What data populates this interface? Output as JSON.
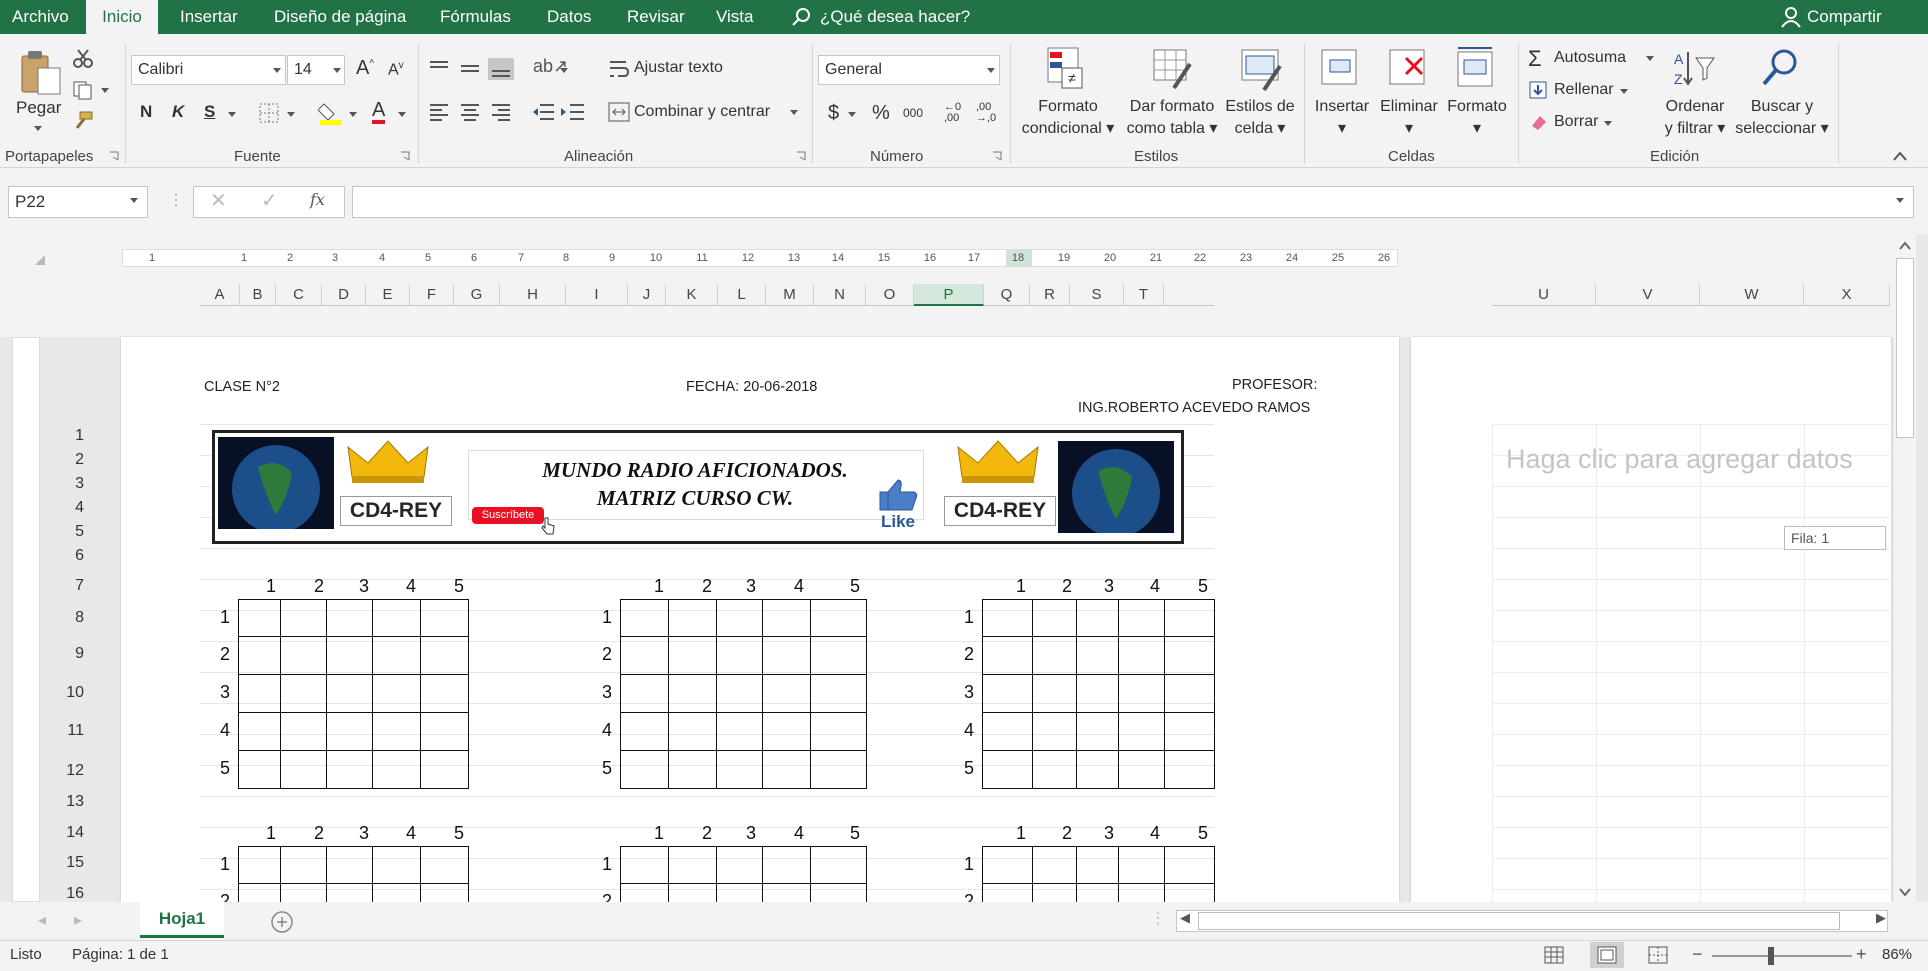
{
  "menu": {
    "items": [
      "Archivo",
      "Inicio",
      "Insertar",
      "Diseño de página",
      "Fórmulas",
      "Datos",
      "Revisar",
      "Vista"
    ],
    "search": "¿Qué desea hacer?",
    "share": "Compartir"
  },
  "ribbon": {
    "portapapeles": {
      "paste": "Pegar",
      "group": "Portapapeles"
    },
    "fuente": {
      "font": "Calibri",
      "size": "14",
      "bold": "N",
      "italic": "K",
      "underline": "S",
      "group": "Fuente"
    },
    "alineacion": {
      "wrap": "Ajustar texto",
      "merge": "Combinar y centrar",
      "group": "Alineación"
    },
    "numero": {
      "format": "General",
      "currency": "$",
      "percent": "%",
      "thousands": "000",
      "group": "Número"
    },
    "estilos": {
      "cond1": "Formato",
      "cond2": "condicional",
      "table1": "Dar formato",
      "table2": "como tabla",
      "cell1": "Estilos de",
      "cell2": "celda",
      "group": "Estilos"
    },
    "celdas": {
      "insert": "Insertar",
      "delete": "Eliminar",
      "format": "Formato",
      "group": "Celdas"
    },
    "edicion": {
      "autosum": "Autosuma",
      "fill": "Rellenar",
      "clear": "Borrar",
      "sort1": "Ordenar",
      "sort2": "y filtrar",
      "find1": "Buscar y",
      "find2": "seleccionar",
      "group": "Edición"
    }
  },
  "formula_bar": {
    "name_box": "P22",
    "fx": "fx",
    "value": ""
  },
  "ruler": [
    "1",
    "1",
    "2",
    "3",
    "4",
    "5",
    "6",
    "7",
    "8",
    "9",
    "10",
    "11",
    "12",
    "13",
    "14",
    "15",
    "16",
    "17",
    "18",
    "19",
    "20",
    "21",
    "22",
    "23",
    "24",
    "25",
    "26"
  ],
  "columns": [
    "A",
    "B",
    "C",
    "D",
    "E",
    "F",
    "G",
    "H",
    "I",
    "J",
    "K",
    "L",
    "M",
    "N",
    "O",
    "P",
    "Q",
    "R",
    "S",
    "T"
  ],
  "columns_right": [
    "U",
    "V",
    "W",
    "X"
  ],
  "rows": [
    "1",
    "2",
    "3",
    "4",
    "5",
    "6",
    "7",
    "8",
    "9",
    "10",
    "11",
    "12",
    "13",
    "14",
    "15",
    "16"
  ],
  "sheet": {
    "header_left": "CLASE N°2",
    "header_center": "FECHA: 20-06-2018",
    "header_right1": "PROFESOR:",
    "header_right2": "ING.ROBERTO ACEVEDO RAMOS",
    "banner_title1": "MUNDO RADIO AFICIONADOS.",
    "banner_title2": "MATRIZ CURSO CW.",
    "callsign": "CD4-REY",
    "subscribe": "Suscríbete",
    "like": "Like",
    "matrix_cols": [
      "1",
      "2",
      "3",
      "4",
      "5"
    ],
    "matrix_rows": [
      "1",
      "2",
      "3",
      "4",
      "5"
    ]
  },
  "right_page": {
    "placeholder": "Haga clic para agregar datos",
    "tooltip": "Fila: 1"
  },
  "sheet_tab": "Hoja1",
  "status": {
    "ready": "Listo",
    "page": "Página: 1 de 1",
    "zoom": "86%"
  },
  "colors": {
    "accent": "#217346",
    "red": "#e81123"
  }
}
